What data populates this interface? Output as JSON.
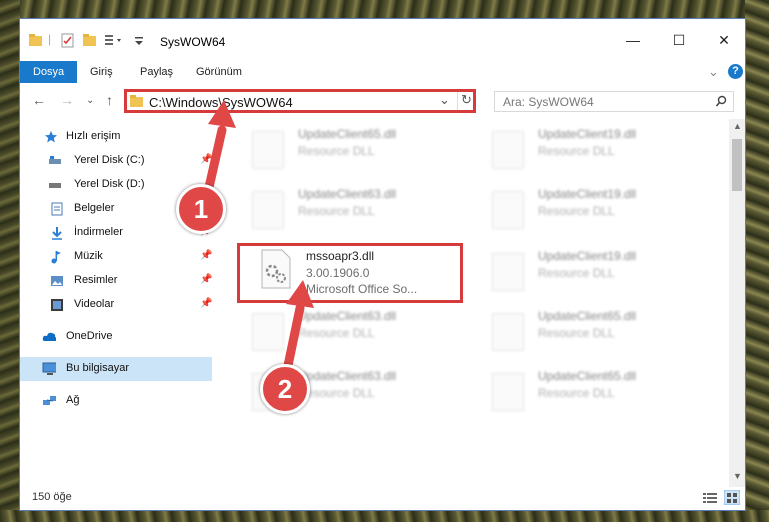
{
  "titlebar": {
    "title": "SysWOW64",
    "minimize_glyph": "—",
    "maximize_glyph": "☐",
    "close_glyph": "✕"
  },
  "ribbon": {
    "tabs": [
      {
        "label": "Dosya",
        "active": true
      },
      {
        "label": "Giriş"
      },
      {
        "label": "Paylaş"
      },
      {
        "label": "Görünüm"
      }
    ],
    "expand_glyph": "⌄",
    "help_glyph": "?"
  },
  "address": {
    "path": "C:\\Windows\\SysWOW64",
    "dropdown_glyph": "⌄",
    "refresh_glyph": "↻"
  },
  "search": {
    "placeholder": "Ara: SysWOW64"
  },
  "sidebar": {
    "items": [
      {
        "label": "Hızlı erişim",
        "icon": "star-icon"
      },
      {
        "label": "Yerel Disk (C:)",
        "icon": "drive-icon",
        "pinned": true
      },
      {
        "label": "Yerel Disk (D:)",
        "icon": "drive-icon"
      },
      {
        "label": "Belgeler",
        "icon": "documents-icon",
        "pinned": true
      },
      {
        "label": "İndirmeler",
        "icon": "download-icon",
        "pinned": true
      },
      {
        "label": "Müzik",
        "icon": "music-icon",
        "pinned": true
      },
      {
        "label": "Resimler",
        "icon": "pictures-icon",
        "pinned": true
      },
      {
        "label": "Videolar",
        "icon": "video-icon",
        "pinned": true
      },
      {
        "label": "OneDrive",
        "icon": "cloud-icon"
      },
      {
        "label": "Bu bilgisayar",
        "icon": "computer-icon",
        "selected": true
      },
      {
        "label": "Ağ",
        "icon": "network-icon"
      }
    ]
  },
  "files": [
    {
      "name": "UpdateClient65.dll",
      "desc": "Resource DLL"
    },
    {
      "name": "UpdateClient19.dll",
      "desc": "Resource DLL"
    },
    {
      "name": "UpdateClient63.dll",
      "desc": "Resource DLL"
    },
    {
      "name": "UpdateClient19.dll",
      "desc": "Resource DLL"
    },
    {
      "name": "mssoapr3.dll",
      "version": "3.00.1906.0",
      "desc": "Microsoft Office So..."
    },
    {
      "name": "UpdateClient19.dll",
      "desc": "Resource DLL"
    },
    {
      "name": "UpdateClient63.dll",
      "desc": "Resource DLL"
    },
    {
      "name": "UpdateClient65.dll",
      "desc": "Resource DLL"
    },
    {
      "name": "UpdateClient63.dll",
      "desc": "Resource DLL"
    },
    {
      "name": "UpdateClient65.dll",
      "desc": "Resource DLL"
    }
  ],
  "status": {
    "item_count": "150 öğe"
  },
  "annotations": {
    "step1": "1",
    "step2": "2"
  },
  "colors": {
    "accent": "#1979ca",
    "highlight": "#d63a3a"
  }
}
